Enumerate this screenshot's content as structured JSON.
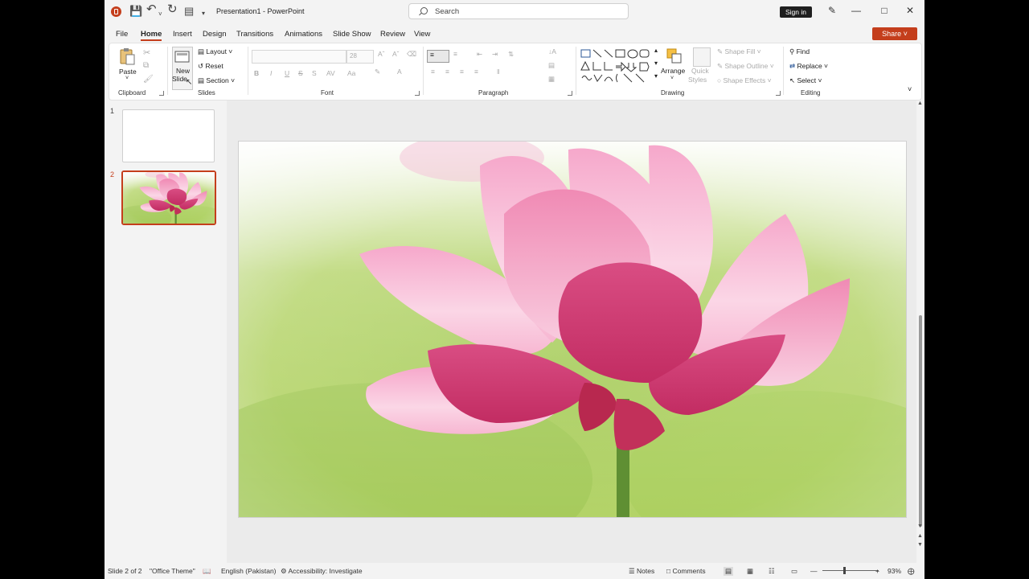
{
  "titlebar": {
    "title": "Presentation1  -  PowerPoint",
    "search_placeholder": "Search",
    "sign_in": "Sign in"
  },
  "menu": {
    "tabs": [
      "File",
      "Home",
      "Insert",
      "Design",
      "Transitions",
      "Animations",
      "Slide Show",
      "Review",
      "View"
    ],
    "active": "Home",
    "share": "Share"
  },
  "ribbon": {
    "clipboard": {
      "label": "Clipboard",
      "paste": "Paste"
    },
    "slides": {
      "label": "Slides",
      "new_slide_line1": "New",
      "new_slide_line2": "Slide",
      "layout": "Layout",
      "reset": "Reset",
      "section": "Section"
    },
    "font": {
      "label": "Font",
      "size": "28",
      "bold": "B",
      "italic": "I",
      "underline": "U",
      "strike": "S"
    },
    "paragraph": {
      "label": "Paragraph"
    },
    "drawing": {
      "label": "Drawing",
      "arrange": "Arrange",
      "quick_styles_line1": "Quick",
      "quick_styles_line2": "Styles",
      "shape_fill": "Shape Fill",
      "shape_outline": "Shape Outline",
      "shape_effects": "Shape Effects"
    },
    "editing": {
      "label": "Editing",
      "find": "Find",
      "replace": "Replace",
      "select": "Select"
    }
  },
  "slides_pane": {
    "items": [
      {
        "number": "1"
      },
      {
        "number": "2"
      }
    ],
    "selected": 2
  },
  "statusbar": {
    "slide_info": "Slide 2 of 2",
    "theme": "\"Office Theme\"",
    "language": "English (Pakistan)",
    "accessibility": "Accessibility: Investigate",
    "notes": "Notes",
    "comments": "Comments",
    "zoom": "93%"
  },
  "colors": {
    "accent": "#c43e1c",
    "ribbon_bg": "#ffffff",
    "window_bg": "#f3f3f3"
  }
}
